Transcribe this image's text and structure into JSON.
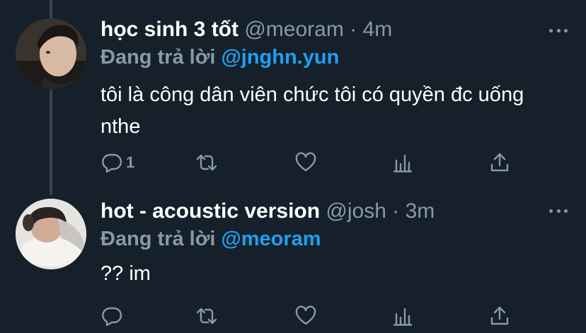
{
  "tweets": [
    {
      "name": "học sinh 3 tốt",
      "handle": "@meoram",
      "separator": "·",
      "time": "4m",
      "reply_prefix": "Đang trả lời",
      "reply_to": "@jnghn.yun",
      "text": "tôi là công dân viên chức tôi có quyền đc uống nthe",
      "reply_count": "1"
    },
    {
      "name": "hot - acoustic version",
      "handle": "@josh",
      "separator": "·",
      "time": "3m",
      "reply_prefix": "Đang trả lời",
      "reply_to": "@meoram",
      "text": "?? im",
      "reply_count": ""
    }
  ],
  "icons": {
    "reply": "reply-icon",
    "retweet": "retweet-icon",
    "like": "heart-icon",
    "stats": "analytics-icon",
    "share": "share-icon",
    "more": "more-icon"
  },
  "colors": {
    "background": "#15202b",
    "secondary_text": "#8899a6",
    "accent": "#1da1f2",
    "thread_line": "#38444d"
  }
}
